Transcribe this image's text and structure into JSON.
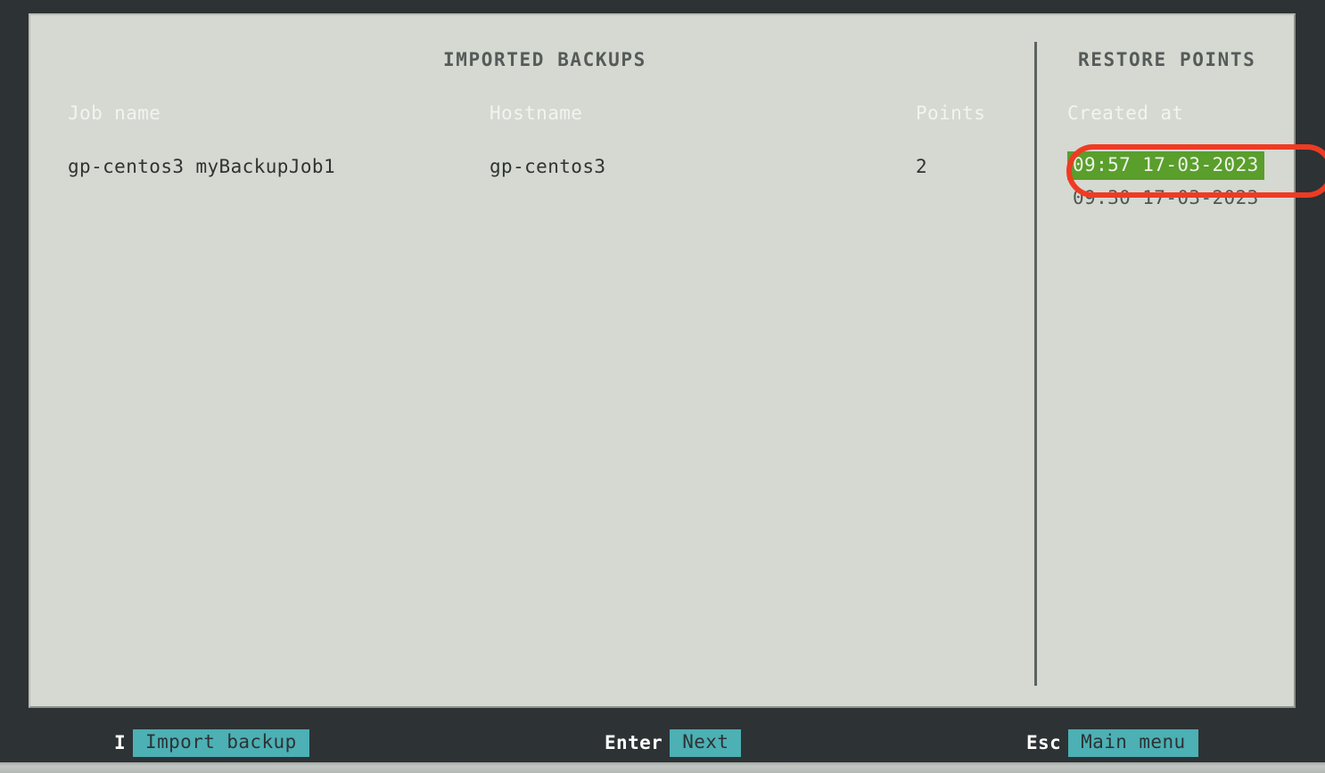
{
  "theme": {
    "outer_background": "#2d3235",
    "panel_background": "#d5d9d1",
    "accent_teal": "#4cb0b4",
    "selection_green": "#5a9e2c",
    "annotation_red": "#ef3b23",
    "header_text": "#f2f4f0",
    "body_text": "#2f3432"
  },
  "panel": {
    "sections": {
      "imported_backups_title": "IMPORTED BACKUPS",
      "restore_points_title": "RESTORE POINTS"
    },
    "backups_table": {
      "columns": [
        "Job name",
        "Hostname",
        "Points"
      ],
      "rows": [
        {
          "job_name": "gp-centos3 myBackupJob1",
          "hostname": "gp-centos3",
          "points": "2"
        }
      ]
    },
    "restore_points": {
      "column": "Created at",
      "items": [
        {
          "created_at": "09:57 17-03-2023",
          "selected": true
        },
        {
          "created_at": "09:30 17-03-2023",
          "selected": false
        }
      ]
    }
  },
  "status_bar": {
    "items": [
      {
        "key": "I",
        "action": "Import backup"
      },
      {
        "key": "Enter",
        "action": "Next"
      },
      {
        "key": "Esc",
        "action": "Main menu"
      }
    ]
  }
}
